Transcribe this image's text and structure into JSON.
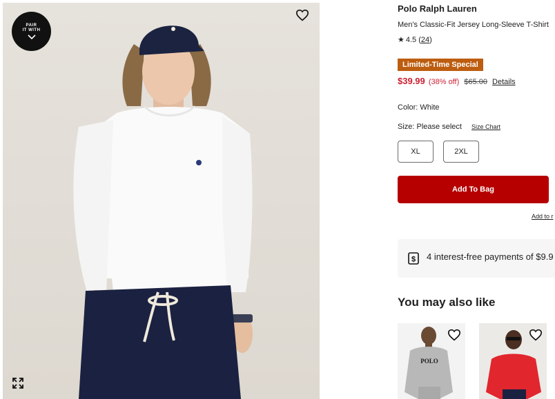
{
  "hero": {
    "pair_badge_line1": "PAIR",
    "pair_badge_line2": "IT WITH",
    "icons": [
      "heart-icon",
      "expand-icon",
      "chevron-down-icon"
    ]
  },
  "product": {
    "brand": "Polo Ralph Lauren",
    "name": "Men's Classic-Fit Jersey Long-Sleeve T-Shirt",
    "rating_star": "★",
    "rating": "4.5",
    "review_count": "24",
    "promo_badge": "Limited-Time Special",
    "sale_price": "$39.99",
    "discount": "(38% off)",
    "original_price": "$65.00",
    "details_link": "Details",
    "color_label": "Color: White",
    "size_label": "Size: Please select",
    "size_chart_link": "Size Chart",
    "sizes": [
      "XL",
      "2XL"
    ],
    "add_to_bag": "Add To Bag",
    "add_to_list": "Add to r",
    "payment_text": "4 interest-free payments of $9.9",
    "colors": {
      "sale": "#cc1f32",
      "button": "#b60000",
      "promo": "#bd5d0f"
    }
  },
  "recommendations": {
    "title": "You may also like",
    "thumb_print": "POLO"
  }
}
